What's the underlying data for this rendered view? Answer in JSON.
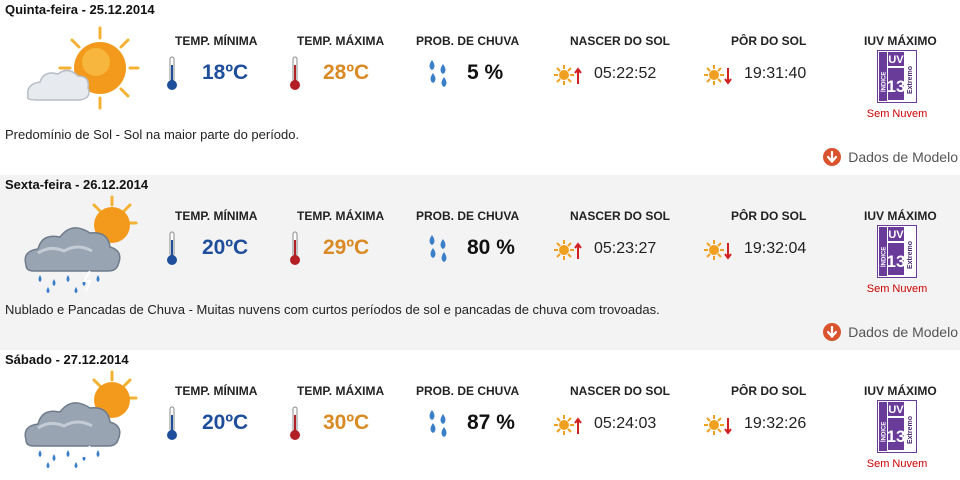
{
  "headers": {
    "temp_min": "TEMP. MÍNIMA",
    "temp_max": "TEMP. MÁXIMA",
    "rain_prob": "PROB. DE CHUVA",
    "sunrise": "NASCER DO SOL",
    "sunset": "PÔR DO SOL",
    "uv_max": "IUV MÁXIMO"
  },
  "model_link_label": "Dados de Modelo",
  "colors": {
    "min_temp": "#1f4f9c",
    "max_temp": "#d98a24",
    "rain_drop": "#3a7fc8",
    "sun": "#f0a020",
    "uv_purple": "#6a3c9a",
    "red_text": "#cc0000",
    "model_icon": "#d9532f"
  },
  "days": [
    {
      "title": "Quinta-feira - 25.12.2014",
      "icon": "sun-with-cloud-icon",
      "temp_min": "18ºC",
      "temp_max": "28ºC",
      "rain_prob": "5 %",
      "sunrise": "05:22:52",
      "sunset": "19:31:40",
      "uv_index": "13",
      "uv_level": "Extremo",
      "uv_index_label": "ÍNDICE",
      "uv_label": "UV",
      "uv_status": "Sem Nuvem",
      "description": "Predomínio de Sol - Sol na maior parte do período."
    },
    {
      "title": "Sexta-feira - 26.12.2014",
      "icon": "storm-cloud-with-sun-icon",
      "temp_min": "20ºC",
      "temp_max": "29ºC",
      "rain_prob": "80 %",
      "sunrise": "05:23:27",
      "sunset": "19:32:04",
      "uv_index": "13",
      "uv_level": "Extremo",
      "uv_index_label": "ÍNDICE",
      "uv_label": "UV",
      "uv_status": "Sem Nuvem",
      "description": "Nublado e Pancadas de Chuva - Muitas nuvens com curtos períodos de sol e pancadas de chuva com trovoadas."
    },
    {
      "title": "Sábado - 27.12.2014",
      "icon": "storm-cloud-with-sun-icon",
      "temp_min": "20ºC",
      "temp_max": "30ºC",
      "rain_prob": "87 %",
      "sunrise": "05:24:03",
      "sunset": "19:32:26",
      "uv_index": "13",
      "uv_level": "Extremo",
      "uv_index_label": "ÍNDICE",
      "uv_label": "UV",
      "uv_status": "Sem Nuvem",
      "description": ""
    }
  ]
}
